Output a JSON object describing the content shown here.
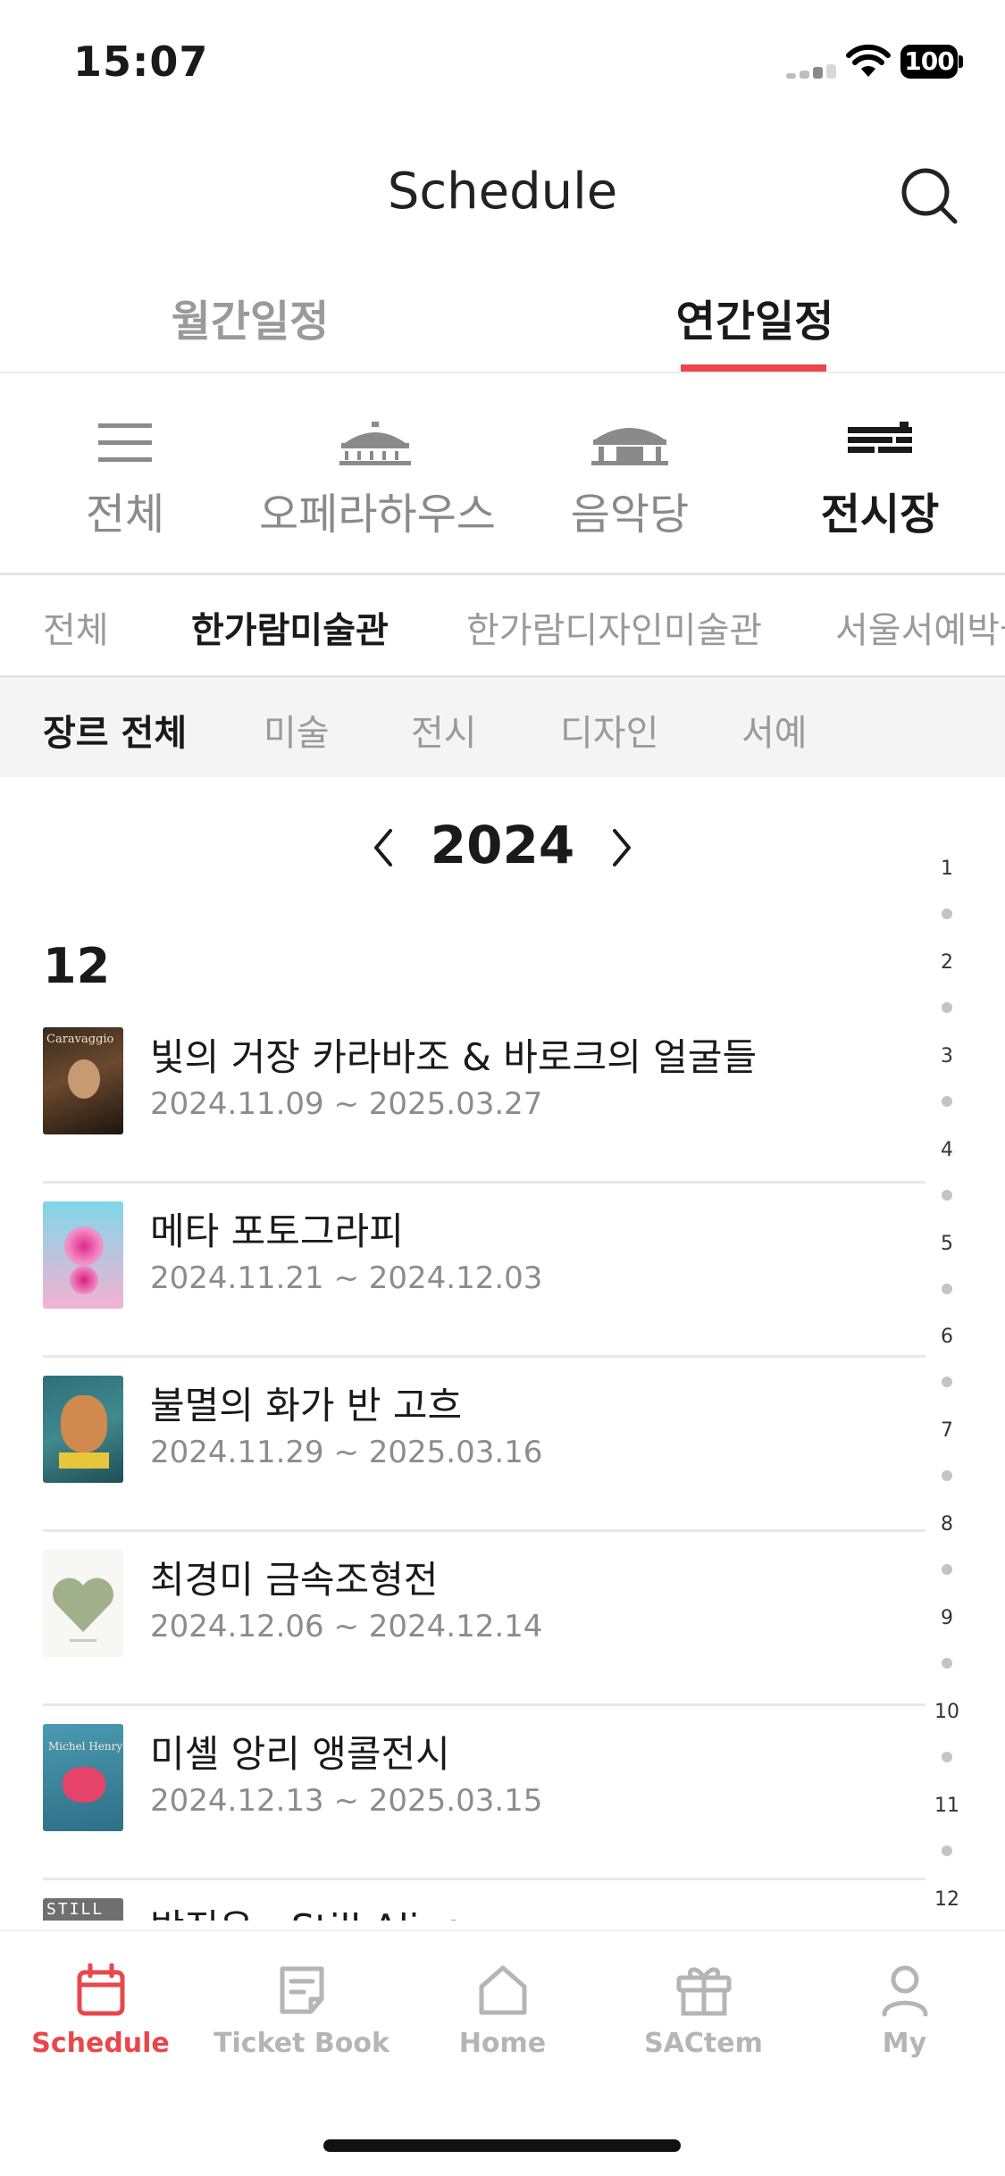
{
  "status_bar": {
    "time": "15:07",
    "battery": "100"
  },
  "header": {
    "title": "Schedule"
  },
  "main_tabs": [
    {
      "label": "월간일정",
      "active": false
    },
    {
      "label": "연간일정",
      "active": true
    }
  ],
  "venues": [
    {
      "label": "전체",
      "icon": "list-icon",
      "active": false
    },
    {
      "label": "오페라하우스",
      "icon": "opera-house-icon",
      "active": false
    },
    {
      "label": "음악당",
      "icon": "concert-hall-icon",
      "active": false
    },
    {
      "label": "전시장",
      "icon": "exhibition-hall-icon",
      "active": true
    }
  ],
  "subvenues": [
    {
      "label": "전체",
      "active": false
    },
    {
      "label": "한가람미술관",
      "active": true
    },
    {
      "label": "한가람디자인미술관",
      "active": false
    },
    {
      "label": "서울서예박물관",
      "active": false
    }
  ],
  "genres": [
    {
      "label": "장르 전체",
      "active": true
    },
    {
      "label": "미술",
      "active": false
    },
    {
      "label": "전시",
      "active": false
    },
    {
      "label": "디자인",
      "active": false
    },
    {
      "label": "서예",
      "active": false
    }
  ],
  "year_nav": {
    "year": "2024"
  },
  "month_heading": "12",
  "events": [
    {
      "title": "빛의 거장 카라바조 & 바로크의 얼굴들",
      "date": "2024.11.09 ~ 2025.03.27",
      "thumb_text": "Caravaggio"
    },
    {
      "title": "메타 포토그라피",
      "date": "2024.11.21 ~ 2024.12.03",
      "thumb_text": ""
    },
    {
      "title": "불멸의 화가 반 고흐",
      "date": "2024.11.29 ~ 2025.03.16",
      "thumb_text": ""
    },
    {
      "title": "최경미 금속조형전",
      "date": "2024.12.06 ~ 2024.12.14",
      "thumb_text": ""
    },
    {
      "title": "미셸 앙리 앵콜전시",
      "date": "2024.12.13 ~ 2025.03.15",
      "thumb_text": "Michel Henry"
    },
    {
      "title": "박진우 - Still Alive",
      "date": "",
      "thumb_text": "STILL"
    }
  ],
  "month_index": [
    "1",
    "2",
    "3",
    "4",
    "5",
    "6",
    "7",
    "8",
    "9",
    "10",
    "11",
    "12"
  ],
  "bottom_nav": [
    {
      "label": "Schedule",
      "icon": "calendar-icon",
      "active": true
    },
    {
      "label": "Ticket Book",
      "icon": "ticket-book-icon",
      "active": false
    },
    {
      "label": "Home",
      "icon": "home-icon",
      "active": false
    },
    {
      "label": "SACtem",
      "icon": "gift-icon",
      "active": false
    },
    {
      "label": "My",
      "icon": "user-icon",
      "active": false
    }
  ],
  "colors": {
    "accent": "#e8474b",
    "inactive": "#9a9a9a",
    "text": "#1a1a1a",
    "genre_bg": "#f4f4f4"
  }
}
